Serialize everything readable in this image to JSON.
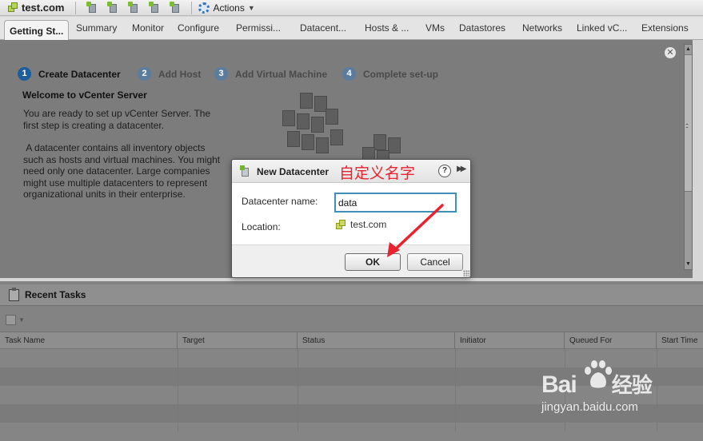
{
  "toolbar": {
    "object_title": "test.com",
    "actions_label": "Actions",
    "icons": [
      "add-host-icon",
      "add-cluster-icon",
      "add-folder-icon",
      "deploy-ovf-icon",
      "import-icon"
    ]
  },
  "tabs": [
    {
      "label": "Getting St...",
      "active": true
    },
    {
      "label": "Summary"
    },
    {
      "label": "Monitor"
    },
    {
      "label": "Configure"
    },
    {
      "label": "Permissi..."
    },
    {
      "label": "Datacent..."
    },
    {
      "label": "Hosts & ..."
    },
    {
      "label": "VMs"
    },
    {
      "label": "Datastores"
    },
    {
      "label": "Networks"
    },
    {
      "label": "Linked vC..."
    },
    {
      "label": "Extensions"
    }
  ],
  "getting_started": {
    "steps": [
      {
        "num": "1",
        "label": "Create Datacenter",
        "active": true
      },
      {
        "num": "2",
        "label": "Add Host"
      },
      {
        "num": "3",
        "label": "Add Virtual Machine"
      },
      {
        "num": "4",
        "label": "Complete set-up"
      }
    ],
    "heading": "Welcome to vCenter Server",
    "para1": "You are ready to set up vCenter Server. The first step is creating a datacenter.",
    "para2": " A datacenter contains all inventory objects such as hosts and virtual machines. You might need only one datacenter. Large companies might use multiple datacenters to represent organizational units in their enterprise."
  },
  "dialog": {
    "title": "New Datacenter",
    "annotation": "自定义名字",
    "help_glyph": "?",
    "name_label": "Datacenter name:",
    "name_value": "data",
    "location_label": "Location:",
    "location_value": "test.com",
    "ok_label": "OK",
    "cancel_label": "Cancel"
  },
  "recent_tasks": {
    "title": "Recent Tasks",
    "columns": [
      "Task Name",
      "Target",
      "Status",
      "Initiator",
      "Queued For",
      "Start Time"
    ]
  },
  "watermark": {
    "logo_left": "Bai",
    "logo_right": "经验",
    "url": "jingyan.baidu.com"
  },
  "colors": {
    "annotation_red": "#e8222e",
    "input_border": "#3f8fb8",
    "step_active": "#1d5d9c"
  }
}
